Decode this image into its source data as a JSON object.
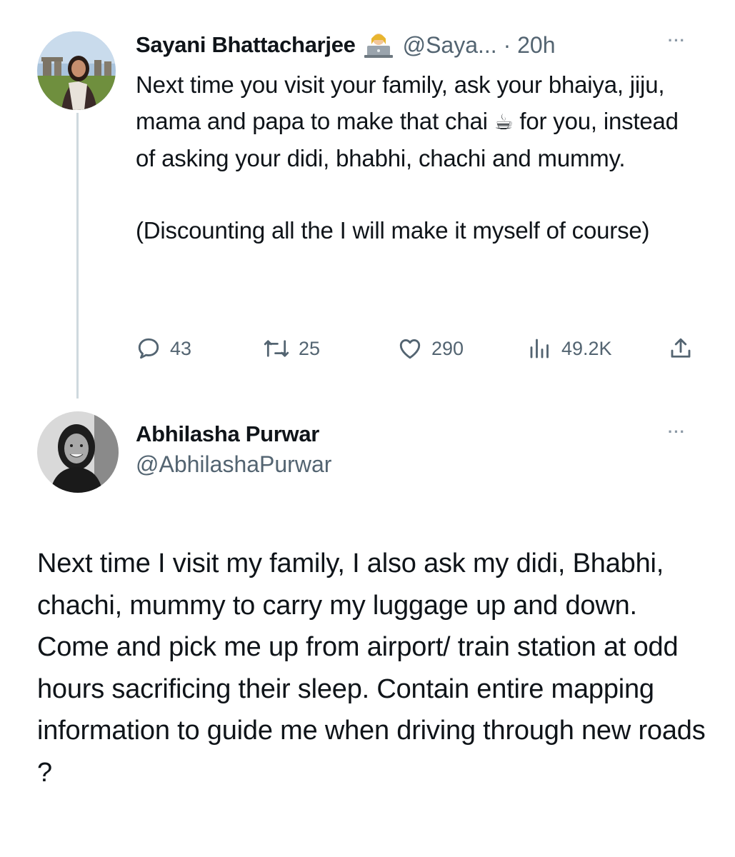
{
  "tweet1": {
    "author_name": "Sayani Bhattacharjee",
    "badge_icon": "person-with-laptop-emoji",
    "handle": "@Saya...",
    "separator": " · ",
    "time": "20h",
    "more": "···",
    "text_before_emoji": "Next time you visit your family, ask your bhaiya, jiju, mama and papa to make that chai ",
    "emoji": "☕",
    "text_after_emoji": " for you, instead of asking your didi, bhabhi, chachi and mummy.",
    "text_para2": "(Discounting all the I will make it myself of course)",
    "actions": {
      "replies": "43",
      "reposts": "25",
      "likes": "290",
      "views": "49.2K"
    }
  },
  "tweet2": {
    "author_name": "Abhilasha Purwar",
    "handle": "@AbhilashaPurwar",
    "more": "···",
    "text": "Next time I visit my family, I also ask my didi, Bhabhi, chachi, mummy to carry my luggage up and down. Come and pick me up from airport/ train station at odd hours sacrificing their sleep. Contain entire mapping information to guide me when driving through new roads ?"
  },
  "colors": {
    "text": "#0f1419",
    "secondary": "#536471",
    "thread_line": "#cfd9de"
  }
}
